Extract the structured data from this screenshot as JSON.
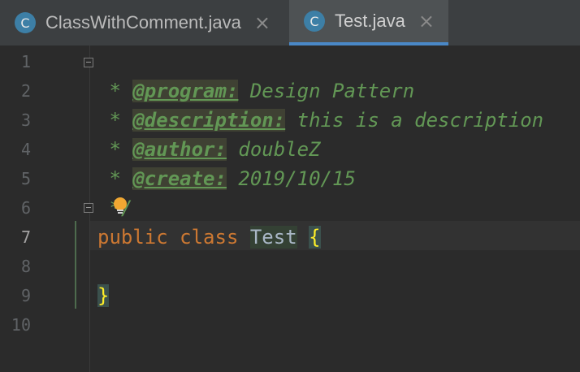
{
  "tabs": [
    {
      "label": "ClassWithComment.java",
      "icon_letter": "C",
      "icon": "java-class-icon",
      "active": false
    },
    {
      "label": "Test.java",
      "icon_letter": "C",
      "icon": "java-class-icon",
      "active": true
    }
  ],
  "close_glyph": "×",
  "line_numbers": [
    "1",
    "2",
    "3",
    "4",
    "5",
    "6",
    "7",
    "8",
    "9",
    "10"
  ],
  "active_line": "7",
  "code": {
    "l1": "/**",
    "l2_star": " * ",
    "l2_tag": "@program:",
    "l2_text": " Design Pattern",
    "l3_star": " * ",
    "l3_tag": "@description:",
    "l3_text": " this is a description",
    "l4_star": " * ",
    "l4_tag": "@author:",
    "l4_text": " doubleZ",
    "l5_star": " * ",
    "l5_tag": "@create:",
    "l5_text": " 2019/10/15",
    "l6": " */",
    "l7_kw1": "public",
    "l7_kw2": "class",
    "l7_name": "Test",
    "l7_brace": "{",
    "l9_brace": "}"
  },
  "colors": {
    "background": "#2b2b2b",
    "comment": "#629755",
    "keyword": "#cc7832",
    "brace": "#ffef28",
    "active_tab_underline": "#4a88c7"
  },
  "icons": {
    "intention": "lightbulb-icon",
    "fold": "fold-marker-icon"
  }
}
